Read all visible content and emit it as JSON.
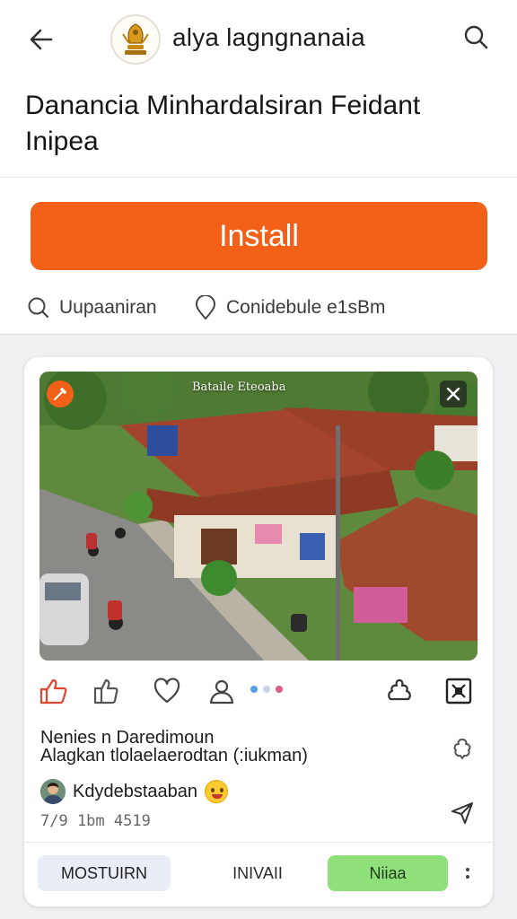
{
  "header": {
    "app_name": "alya lagngnanaia",
    "back_icon": "arrow-left-icon",
    "search_icon": "search-icon",
    "logo_icon": "emblem-logo-icon"
  },
  "page": {
    "title": "Danancia Minhardalsiran Feidant Inipea"
  },
  "install_button": {
    "label": "Install",
    "color": "#f36118"
  },
  "meta": [
    {
      "icon": "search-icon",
      "text": "Uupaaniran"
    },
    {
      "icon": "location-pin-icon",
      "text": "Conidebule e1sBm"
    }
  ],
  "post": {
    "photo_caption": "Bataile Eteoaba",
    "title_line1": "Nenies n Daredimoun",
    "title_line2": "Alagkan tlolaelaerodtan (:iukman)",
    "author": "Kdydebstaaban",
    "timestamp": "7/9 1bm 4519",
    "carousel_dots": [
      "#5aa0e6",
      "#c7d5e8",
      "#e05a8a"
    ]
  },
  "actions": [
    {
      "name": "like-icon"
    },
    {
      "name": "thumbs-up-icon"
    },
    {
      "name": "heart-icon"
    },
    {
      "name": "profile-icon"
    },
    {
      "name": "share-icon"
    },
    {
      "name": "expand-icon"
    }
  ],
  "footer": {
    "button_a": "MOSTUIRN",
    "button_b": "INIVAII",
    "button_c": "Niiaa",
    "accent_green": "#8fe07a"
  }
}
